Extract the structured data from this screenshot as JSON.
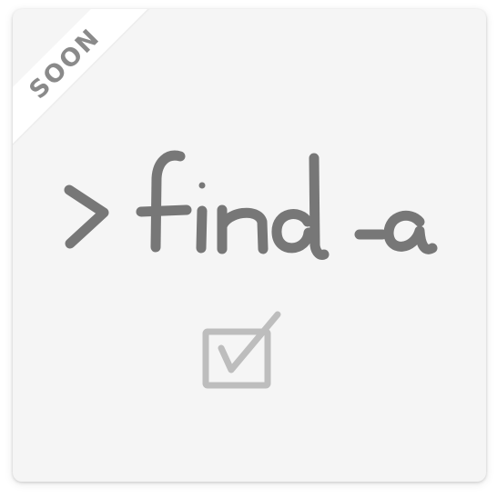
{
  "badge": {
    "label": "SOON"
  },
  "illustration": {
    "command_text": "> find -a",
    "command_icon": "greater-than-prompt-icon",
    "check_icon": "checked-box-icon"
  },
  "colors": {
    "card_background": "#f5f5f5",
    "ribbon_background": "#ffffff",
    "ribbon_text": "#8a8a8a",
    "ink": "#777777",
    "checkbox": "#bdbdbd"
  }
}
